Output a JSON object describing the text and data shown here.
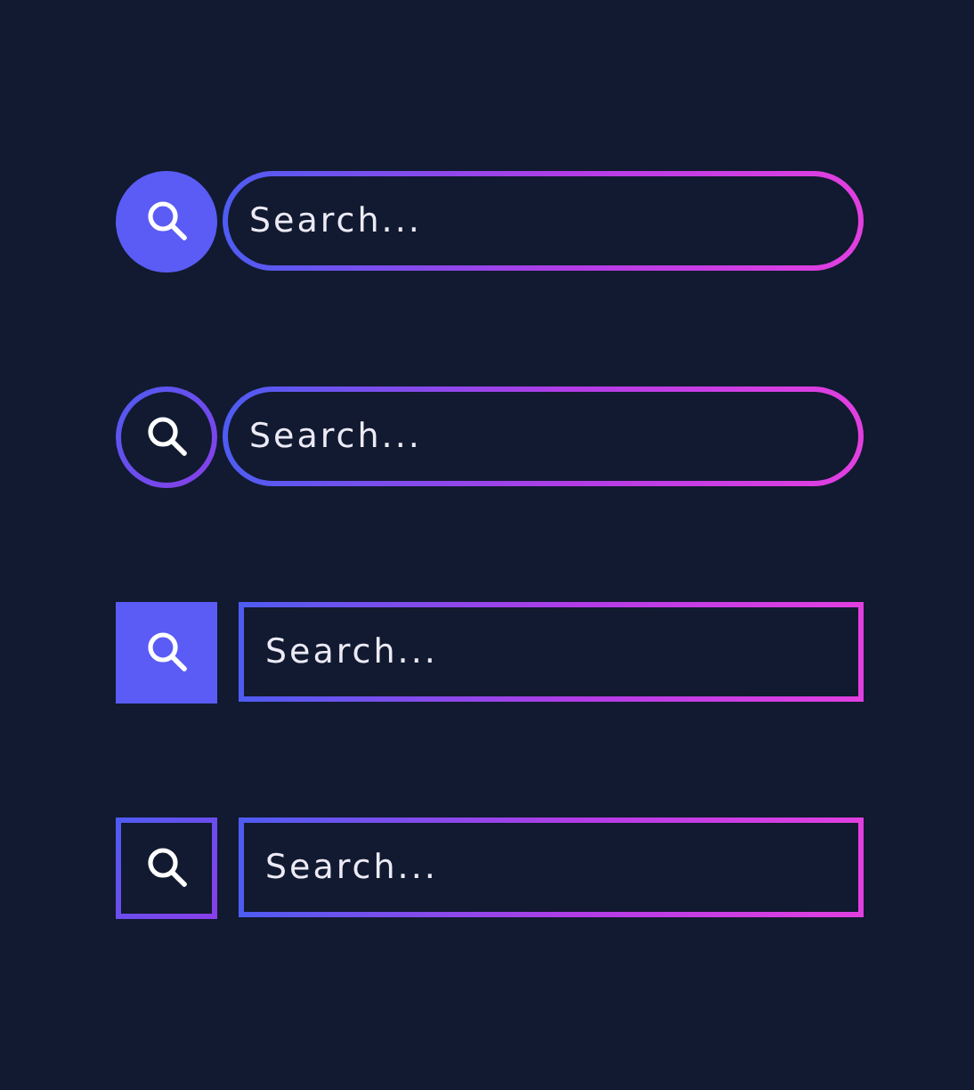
{
  "search_bars": [
    {
      "kind": "round-filled",
      "placeholder": "Search..."
    },
    {
      "kind": "round-outline",
      "placeholder": "Search..."
    },
    {
      "kind": "square-filled",
      "placeholder": "Search..."
    },
    {
      "kind": "square-outline",
      "placeholder": "Search..."
    }
  ]
}
